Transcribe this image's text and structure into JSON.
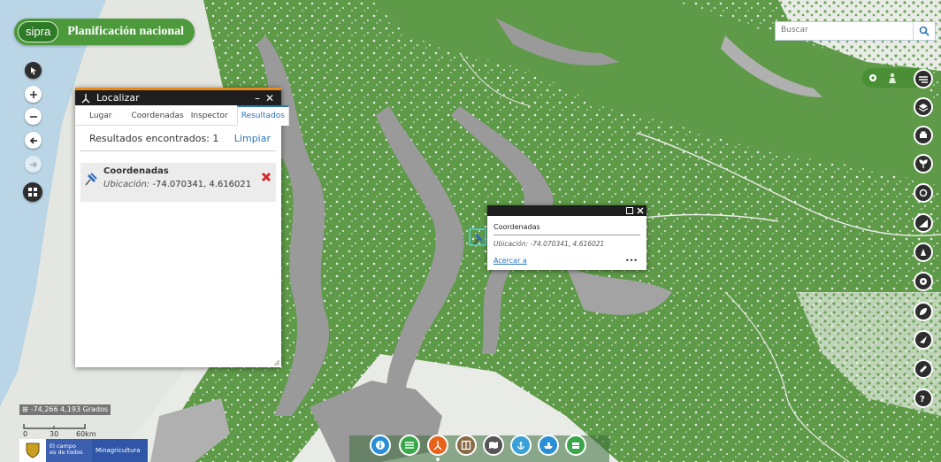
{
  "header": {
    "logo_text": "sipra",
    "title": "Planificación nacional",
    "search_placeholder": "Buscar"
  },
  "left_controls": [
    "pointer-icon",
    "zoom-in-icon",
    "zoom-out-icon",
    "back-icon",
    "forward-icon",
    "grid-icon"
  ],
  "panel": {
    "title": "Localizar",
    "minimize": "–",
    "close": "✕",
    "tabs": [
      {
        "label": "Lugar",
        "active": false
      },
      {
        "label": "Coordenadas",
        "active": false
      },
      {
        "label": "Inspector",
        "active": false
      },
      {
        "label": "Resultados",
        "active": true
      }
    ],
    "results_label": "Resultados encontrados: 1",
    "clear_label": "Limpiar",
    "result": {
      "title": "Coordenadas",
      "location_label": "Ubicación:",
      "location_value": "-74.070341, 4.616021"
    }
  },
  "popup": {
    "title": "Coordenadas",
    "location": "Ubicación: -74.070341, 4.616021",
    "zoom_link": "Acercar a",
    "more": "•••"
  },
  "status": {
    "coordinates": "-74,266 4,193 Grados",
    "scale_labels": [
      "0",
      "30",
      "60km"
    ]
  },
  "footer_logos": {
    "campo_line1": "El campo",
    "campo_line2": "es de todos",
    "ministry": "Minagricultura"
  },
  "right_tools": [
    "layers-list-icon",
    "layers-icon",
    "print-icon",
    "plant-icon",
    "search-location-icon",
    "chart-icon",
    "crop-icon",
    "globe-icon",
    "leaf-icon",
    "compass-icon",
    "measure-icon",
    "help-icon"
  ],
  "bottom_tools": [
    {
      "icon": "info-icon",
      "color": "#2a8fd8"
    },
    {
      "icon": "list-icon",
      "color": "#3aa84a"
    },
    {
      "icon": "locate-icon",
      "color": "#e8621c"
    },
    {
      "icon": "compare-icon",
      "color": "#8a6a45"
    },
    {
      "icon": "map-icon",
      "color": "#555555"
    },
    {
      "icon": "anchor-icon",
      "color": "#3aa0d8"
    },
    {
      "icon": "ship-icon",
      "color": "#2a8fd8"
    },
    {
      "icon": "stack-icon",
      "color": "#3aa84a"
    }
  ],
  "colors": {
    "vegetation": "#5e9a48",
    "terrain": "#9a9a9a",
    "land": "#e9ebe7",
    "water": "#b9d5e6",
    "accent": "#e8891c",
    "link": "#2a74b8"
  }
}
